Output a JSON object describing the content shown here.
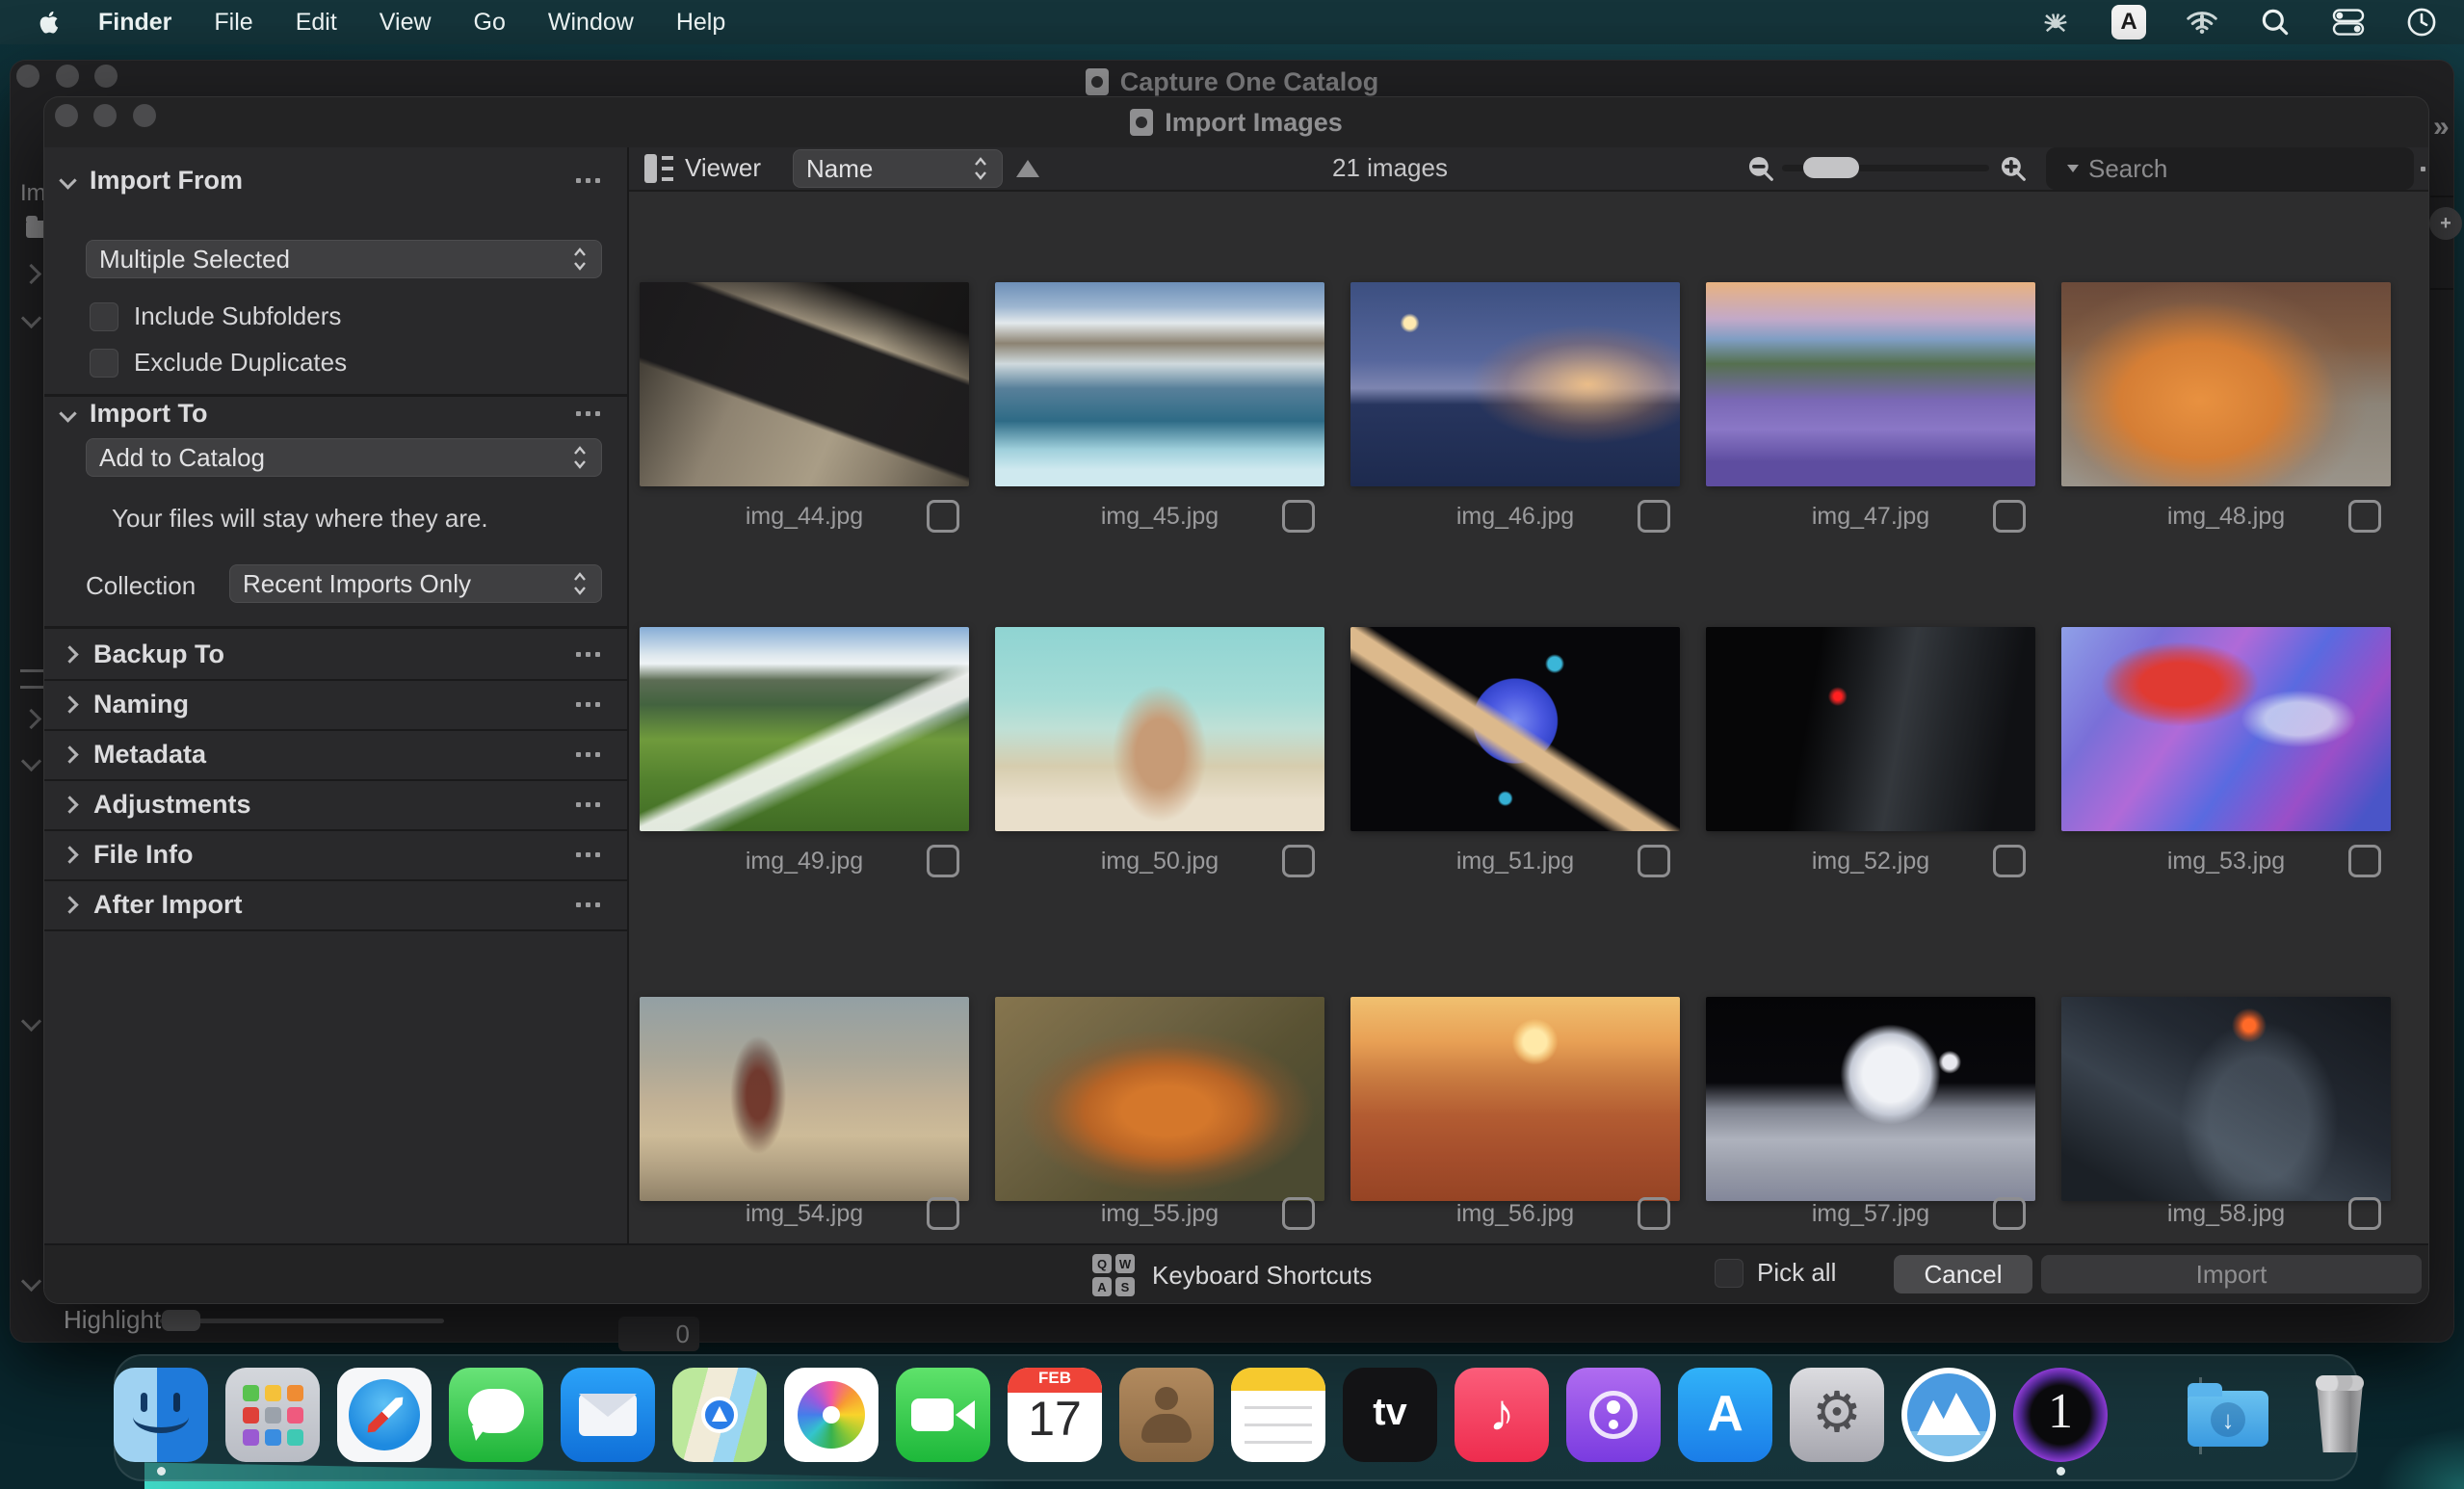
{
  "menu_bar": {
    "items": [
      "Finder",
      "File",
      "Edit",
      "View",
      "Go",
      "Window",
      "Help"
    ],
    "input_source_letter": "A",
    "status_icons": [
      "antivirus-spider",
      "input-source-a",
      "wifi-alert",
      "spotlight-search",
      "control-center",
      "clock"
    ]
  },
  "background_window": {
    "title": "Capture One Catalog",
    "highlight_label": "Highlight",
    "highlight_value": "0"
  },
  "dialog": {
    "title": "Import Images",
    "sidebar": {
      "import_from": {
        "label": "Import From",
        "source": "Multiple Selected",
        "checkboxes": [
          {
            "label": "Include Subfolders",
            "checked": false
          },
          {
            "label": "Exclude Duplicates",
            "checked": false
          }
        ]
      },
      "import_to": {
        "label": "Import To",
        "destination": "Add to Catalog",
        "note": "Your files will stay where they are.",
        "collection_label": "Collection",
        "collection_value": "Recent Imports Only"
      },
      "collapsed_sections": [
        {
          "label": "Backup To"
        },
        {
          "label": "Naming"
        },
        {
          "label": "Metadata"
        },
        {
          "label": "Adjustments"
        },
        {
          "label": "File Info"
        },
        {
          "label": "After Import"
        }
      ]
    },
    "toolbar": {
      "viewer_label": "Viewer",
      "sort_by": "Name",
      "count": "21 images",
      "search_placeholder": "Search"
    },
    "grid": {
      "images": [
        {
          "filename": "img_44.jpg",
          "checked": false,
          "art": "linear-gradient(200deg, rgba(10,10,12,0.9) 0 16%, transparent 30%), linear-gradient(20deg, rgba(15,15,18,0) 38%, rgba(26,25,27,0.95) 40% 68%, rgba(15,15,18,0) 70%), linear-gradient(115deg, #2b2823 0%, #8e8371 35%, #a99d86 62%, #8a7f6c 78%, #4e483d 100%)"
        },
        {
          "filename": "img_45.jpg",
          "checked": false,
          "art": "linear-gradient(180deg, #6d8fb8 0%, #9db6d0 12%, #e3e9ec 20%, #8c8372 30%, #cfd9dd 40%, #58809a 52%, #2e6b86 68%, #9fd0dc 82%, #cfe9ef 92%)"
        },
        {
          "filename": "img_46.jpg",
          "checked": false,
          "art": "radial-gradient(ellipse 55% 45% at 72% 50%, rgba(255,200,130,0.85), rgba(180,120,80,0.3) 45%, transparent 65%), radial-gradient(circle 10px at 18% 20%, #ffe9b0 0 60%, transparent 100%), linear-gradient(180deg, #3c4f80 0%, #56669c 38%, #7d85b0 52%, #27355e 60%, #1d2a4e 100%)"
        },
        {
          "filename": "img_47.jpg",
          "checked": false,
          "art": "linear-gradient(180deg, #e8b280 0%, #c3a9c8 18%, #7f9ec4 28%, #55704f 40%, #7a68b5 58%, #8a77c6 72%, #5e4da0 88%)"
        },
        {
          "filename": "img_48.jpg",
          "checked": false,
          "art": "radial-gradient(ellipse 60% 70% at 42% 58%, #e89140 0%, #d57e35 40%, rgba(150,110,80,0.3) 70%, transparent 85%), linear-gradient(180deg, #6b4a3a 0%, #7d5a42 30%, #8c8478 60%, #9a948a 100%)"
        },
        {
          "filename": "img_49.jpg",
          "checked": false,
          "art": "linear-gradient(155deg, transparent 52%, rgba(255,255,255,0.85) 56% 62%, rgba(220,235,240,0.5) 64%, transparent 68%), linear-gradient(180deg, #86add6 0%, #dfe8ee 14%, #eef3f5 18%, #5d6d55 26%, #43633f 38%, #6f9a3c 55%, #53812e 75%, #3f6b24 100%)"
        },
        {
          "filename": "img_50.jpg",
          "checked": false,
          "art": "radial-gradient(ellipse 18% 42% at 50% 62%, #c79b76 0 40%, rgba(199,155,118,0.5) 60%, transparent 80%), linear-gradient(180deg, #8fd4d2 0%, #a5dcd6 35%, #bfe0d6 50%, #d6cdae 68%, #e9dfcb 85%)"
        },
        {
          "filename": "img_51.jpg",
          "checked": false,
          "art": "linear-gradient(33deg, transparent 40%, #dcb98c 44% 49%, transparent 52%), radial-gradient(circle 62px at 50% 46%, #7b8cf0 0%, #4a58e0 45%, #3344cc 70%, transparent 72%), radial-gradient(circle 10px at 62% 18%, #3ab6d8 0 70%, transparent 100%), radial-gradient(circle 8px at 47% 84%, #35b0d4 0 70%, transparent 100%), #07070a"
        },
        {
          "filename": "img_52.jpg",
          "checked": false,
          "art": "radial-gradient(circle 10px at 40% 34%, #ff2020 0 40%, rgba(255,40,40,0.55) 70%, transparent 100%), linear-gradient(100deg, #060607 0 32%, #1b1d20 45%, #34383d 58%, #24272b 70%, #101114 88%)"
        },
        {
          "filename": "img_53.jpg",
          "checked": false,
          "art": "radial-gradient(ellipse 30% 26% at 36% 28%, #e03a32 0 40%, rgba(224,58,50,0.6) 60%, transparent 80%), radial-gradient(ellipse 25% 20% at 72% 45%, rgba(230,235,245,0.7) 0 40%, transparent 70%), linear-gradient(125deg, #8fa0e8 0%, #7a6fd8 22%, #b06ad8 40%, #5a6ae0 58%, #9a4fc8 76%, #4a55c8 92%)"
        },
        {
          "filename": "img_54.jpg",
          "checked": false,
          "art": "radial-gradient(ellipse 10% 34% at 36% 48%, rgba(105,45,35,0.9) 0 35%, rgba(80,40,35,0.5) 60%, transparent 85%), linear-gradient(180deg, #93a0a4 0%, #a9a698 30%, #c2b195 52%, #cdbb98 68%, #b2a183 84%, #8f8168 100%)"
        },
        {
          "filename": "img_55.jpg",
          "checked": false,
          "art": "radial-gradient(ellipse 45% 40% at 52% 56%, #d4772b 0 30%, #b86426 55%, rgba(150,90,45,0.4) 80%, transparent 100%), linear-gradient(140deg, #86754e 0%, #6d6242 35%, #595233 60%, #4b4a31 85%)"
        },
        {
          "filename": "img_56.jpg",
          "checked": false,
          "art": "radial-gradient(circle 24px at 56% 22%, #ffe9a8 0 50%, rgba(255,220,140,0.5) 80%, transparent 100%), linear-gradient(180deg, #f0c070 0%, #e8a055 22%, #c87a40 40%, #b35c32 58%, #a54e2c 78%, #964424 100%)"
        },
        {
          "filename": "img_57.jpg",
          "checked": false,
          "art": "radial-gradient(circle 52px at 56% 38%, #f0f2f6 0 55%, #c5cad6 80%, transparent 100%), radial-gradient(circle 12px at 74% 32%, #e8e8ee 0 60%, transparent 100%), linear-gradient(180deg, #050507 0%, #08080c 42%, #7e828e 55%, #aeb2bd 70%, #979ba8 85%, #83879a 100%)"
        },
        {
          "filename": "img_58.jpg",
          "checked": false,
          "art": "radial-gradient(circle 18px at 57% 14%, #ff6a28 0 35%, rgba(230,90,35,0.55) 65%, transparent 100%), radial-gradient(ellipse 30% 60% at 60% 60%, rgba(120,135,150,0.35) 0 50%, transparent 80%), linear-gradient(210deg, #14171c 0%, #232932 40%, #39424d 62%, #1b2026 88%)"
        }
      ]
    },
    "footer": {
      "keyboard_shortcuts": "Keyboard Shortcuts",
      "keyboard_keys": [
        "Q",
        "W",
        "A",
        "S"
      ],
      "pick_all": "Pick all",
      "pick_all_checked": false,
      "cancel": "Cancel",
      "import": "Import"
    }
  },
  "dock": {
    "apps": [
      {
        "id": "finder",
        "label": "Finder",
        "running": true
      },
      {
        "id": "launchpad",
        "label": "Launchpad"
      },
      {
        "id": "safari",
        "label": "Safari"
      },
      {
        "id": "messages",
        "label": "Messages"
      },
      {
        "id": "mail",
        "label": "Mail"
      },
      {
        "id": "maps",
        "label": "Maps"
      },
      {
        "id": "photos",
        "label": "Photos"
      },
      {
        "id": "facetime",
        "label": "FaceTime"
      },
      {
        "id": "calendar",
        "label": "Calendar",
        "t1": "FEB",
        "t2": "17"
      },
      {
        "id": "contacts",
        "label": "Contacts"
      },
      {
        "id": "notes",
        "label": "Notes"
      },
      {
        "id": "tv",
        "label": "Apple TV",
        "t1": "tv"
      },
      {
        "id": "music",
        "label": "Music",
        "t1": "♪"
      },
      {
        "id": "podcasts",
        "label": "Podcasts"
      },
      {
        "id": "appstore",
        "label": "App Store",
        "t1": "A"
      },
      {
        "id": "settings",
        "label": "System Settings",
        "t1": "⚙"
      },
      {
        "id": "mountain",
        "label": "Mountain App"
      },
      {
        "id": "captureone",
        "label": "Capture One",
        "t1": "1",
        "running": true
      },
      {
        "id": "divider",
        "label": "divider"
      },
      {
        "id": "downloads",
        "label": "Downloads",
        "t1": "↓"
      },
      {
        "id": "trash",
        "label": "Trash"
      }
    ]
  },
  "colors": {
    "menubar_bg": "#15343a",
    "dialog_bg": "#232324",
    "sidebar_bg": "#29292b",
    "grid_bg": "#2d2d2e",
    "accent_text": "#dcdcde"
  }
}
